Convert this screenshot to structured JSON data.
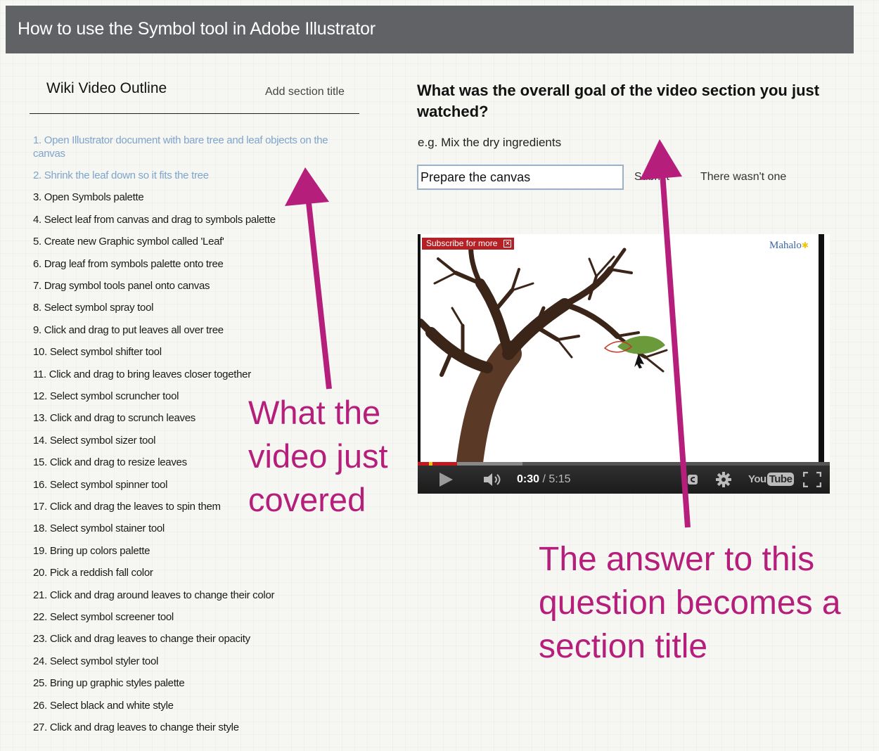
{
  "header": {
    "title": "How to use the Symbol tool in Adobe Illustrator"
  },
  "outline": {
    "title": "Wiki Video Outline",
    "add_section_label": "Add section title",
    "items": [
      {
        "text": "1. Open Illustrator document with bare tree and leaf objects on the canvas",
        "status": "highlighted"
      },
      {
        "text": "2. Shrink the leaf down so it fits the tree",
        "status": "highlighted"
      },
      {
        "text": "3. Open Symbols palette",
        "status": "normal"
      },
      {
        "text": "4. Select leaf from canvas and drag to symbols palette",
        "status": "normal"
      },
      {
        "text": "5. Create new Graphic symbol called 'Leaf'",
        "status": "normal"
      },
      {
        "text": "6. Drag leaf from symbols palette onto tree",
        "status": "normal"
      },
      {
        "text": "7. Drag symbol tools panel onto canvas",
        "status": "normal"
      },
      {
        "text": "8. Select symbol spray tool",
        "status": "normal"
      },
      {
        "text": "9. Click and drag to put leaves all over tree",
        "status": "normal"
      },
      {
        "text": "10. Select symbol shifter tool",
        "status": "normal"
      },
      {
        "text": "11. Click and drag to bring leaves closer together",
        "status": "normal"
      },
      {
        "text": "12. Select symbol scruncher tool",
        "status": "normal"
      },
      {
        "text": "13. Click and drag to scrunch leaves",
        "status": "normal"
      },
      {
        "text": "14. Select symbol sizer tool",
        "status": "normal"
      },
      {
        "text": "15. Click and drag to resize leaves",
        "status": "normal"
      },
      {
        "text": "16. Select symbol spinner tool",
        "status": "normal"
      },
      {
        "text": "17. Click and drag the leaves to spin them",
        "status": "normal"
      },
      {
        "text": "18. Select symbol stainer tool",
        "status": "normal"
      },
      {
        "text": "19. Bring up colors palette",
        "status": "normal"
      },
      {
        "text": "20. Pick a reddish fall color",
        "status": "normal"
      },
      {
        "text": "21. Click and drag around leaves to change their color",
        "status": "normal"
      },
      {
        "text": "22. Select symbol screener tool",
        "status": "normal"
      },
      {
        "text": "23. Click and drag leaves to change their opacity",
        "status": "normal"
      },
      {
        "text": "24. Select symbol styler tool",
        "status": "normal"
      },
      {
        "text": "25. Bring up graphic styles palette",
        "status": "normal"
      },
      {
        "text": "26. Select black and white style",
        "status": "normal"
      },
      {
        "text": "27. Click and drag leaves to change their style",
        "status": "normal"
      }
    ]
  },
  "question": {
    "text": "What was the overall goal of the video section you just watched?",
    "example": "e.g. Mix the dry ingredients",
    "input_value": "Prepare the canvas",
    "submit_label": "Submit",
    "none_label": "There wasn't one"
  },
  "video": {
    "subscribe_label": "Subscribe for more",
    "brand_label": "Mahalo",
    "current_time": "0:30",
    "duration": "/ 5:15",
    "played_fraction": 0.095,
    "buffered_fraction": 0.255,
    "youtube_label": "You",
    "youtube_tube": "Tube",
    "icons": [
      "play-icon",
      "volume-icon",
      "captions-icon",
      "settings-gear-icon",
      "fullscreen-icon"
    ]
  },
  "annotations": {
    "left": "What the video just covered",
    "right": "The answer to this question becomes a section title",
    "color": "#b61e7c"
  },
  "colors": {
    "header_bg": "#606266",
    "completed_item": "#7ea5cc",
    "progress_red": "#c4181e"
  }
}
